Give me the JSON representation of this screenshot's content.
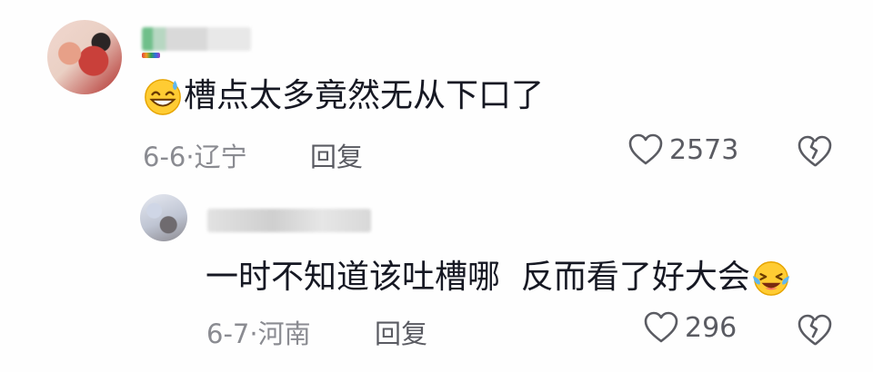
{
  "comments": [
    {
      "text": "槽点太多竟然无从下口了",
      "emoji_icon": "grinning-sweat-icon",
      "date": "6-6",
      "separator": "·",
      "location": "辽宁",
      "reply_label": "回复",
      "likes": "2573"
    },
    {
      "text": "一时不知道该吐槽哪  反而看了好大会",
      "emoji_icon": "laughing-tears-icon",
      "date": "6-7",
      "separator": "·",
      "location": "河南",
      "reply_label": "回复",
      "likes": "296"
    }
  ],
  "colors": {
    "meta": "#8a8b91",
    "reply": "#5a5b62",
    "text": "#161823"
  }
}
